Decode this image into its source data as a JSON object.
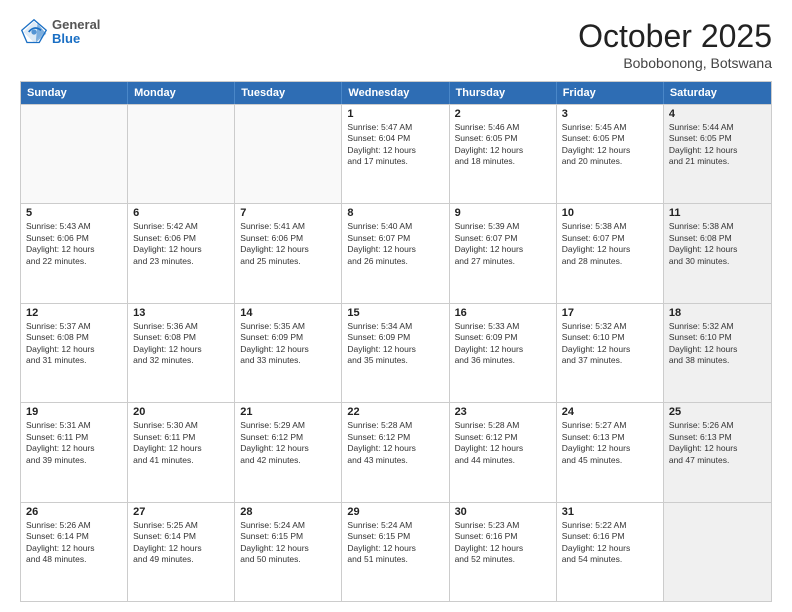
{
  "header": {
    "logo": {
      "general": "General",
      "blue": "Blue"
    },
    "title": "October 2025",
    "location": "Bobobonong, Botswana"
  },
  "days_of_week": [
    "Sunday",
    "Monday",
    "Tuesday",
    "Wednesday",
    "Thursday",
    "Friday",
    "Saturday"
  ],
  "weeks": [
    [
      {
        "day": "",
        "empty": true,
        "shaded": false,
        "lines": []
      },
      {
        "day": "",
        "empty": true,
        "shaded": false,
        "lines": []
      },
      {
        "day": "",
        "empty": true,
        "shaded": false,
        "lines": []
      },
      {
        "day": "1",
        "empty": false,
        "shaded": false,
        "lines": [
          "Sunrise: 5:47 AM",
          "Sunset: 6:04 PM",
          "Daylight: 12 hours",
          "and 17 minutes."
        ]
      },
      {
        "day": "2",
        "empty": false,
        "shaded": false,
        "lines": [
          "Sunrise: 5:46 AM",
          "Sunset: 6:05 PM",
          "Daylight: 12 hours",
          "and 18 minutes."
        ]
      },
      {
        "day": "3",
        "empty": false,
        "shaded": false,
        "lines": [
          "Sunrise: 5:45 AM",
          "Sunset: 6:05 PM",
          "Daylight: 12 hours",
          "and 20 minutes."
        ]
      },
      {
        "day": "4",
        "empty": false,
        "shaded": true,
        "lines": [
          "Sunrise: 5:44 AM",
          "Sunset: 6:05 PM",
          "Daylight: 12 hours",
          "and 21 minutes."
        ]
      }
    ],
    [
      {
        "day": "5",
        "empty": false,
        "shaded": false,
        "lines": [
          "Sunrise: 5:43 AM",
          "Sunset: 6:06 PM",
          "Daylight: 12 hours",
          "and 22 minutes."
        ]
      },
      {
        "day": "6",
        "empty": false,
        "shaded": false,
        "lines": [
          "Sunrise: 5:42 AM",
          "Sunset: 6:06 PM",
          "Daylight: 12 hours",
          "and 23 minutes."
        ]
      },
      {
        "day": "7",
        "empty": false,
        "shaded": false,
        "lines": [
          "Sunrise: 5:41 AM",
          "Sunset: 6:06 PM",
          "Daylight: 12 hours",
          "and 25 minutes."
        ]
      },
      {
        "day": "8",
        "empty": false,
        "shaded": false,
        "lines": [
          "Sunrise: 5:40 AM",
          "Sunset: 6:07 PM",
          "Daylight: 12 hours",
          "and 26 minutes."
        ]
      },
      {
        "day": "9",
        "empty": false,
        "shaded": false,
        "lines": [
          "Sunrise: 5:39 AM",
          "Sunset: 6:07 PM",
          "Daylight: 12 hours",
          "and 27 minutes."
        ]
      },
      {
        "day": "10",
        "empty": false,
        "shaded": false,
        "lines": [
          "Sunrise: 5:38 AM",
          "Sunset: 6:07 PM",
          "Daylight: 12 hours",
          "and 28 minutes."
        ]
      },
      {
        "day": "11",
        "empty": false,
        "shaded": true,
        "lines": [
          "Sunrise: 5:38 AM",
          "Sunset: 6:08 PM",
          "Daylight: 12 hours",
          "and 30 minutes."
        ]
      }
    ],
    [
      {
        "day": "12",
        "empty": false,
        "shaded": false,
        "lines": [
          "Sunrise: 5:37 AM",
          "Sunset: 6:08 PM",
          "Daylight: 12 hours",
          "and 31 minutes."
        ]
      },
      {
        "day": "13",
        "empty": false,
        "shaded": false,
        "lines": [
          "Sunrise: 5:36 AM",
          "Sunset: 6:08 PM",
          "Daylight: 12 hours",
          "and 32 minutes."
        ]
      },
      {
        "day": "14",
        "empty": false,
        "shaded": false,
        "lines": [
          "Sunrise: 5:35 AM",
          "Sunset: 6:09 PM",
          "Daylight: 12 hours",
          "and 33 minutes."
        ]
      },
      {
        "day": "15",
        "empty": false,
        "shaded": false,
        "lines": [
          "Sunrise: 5:34 AM",
          "Sunset: 6:09 PM",
          "Daylight: 12 hours",
          "and 35 minutes."
        ]
      },
      {
        "day": "16",
        "empty": false,
        "shaded": false,
        "lines": [
          "Sunrise: 5:33 AM",
          "Sunset: 6:09 PM",
          "Daylight: 12 hours",
          "and 36 minutes."
        ]
      },
      {
        "day": "17",
        "empty": false,
        "shaded": false,
        "lines": [
          "Sunrise: 5:32 AM",
          "Sunset: 6:10 PM",
          "Daylight: 12 hours",
          "and 37 minutes."
        ]
      },
      {
        "day": "18",
        "empty": false,
        "shaded": true,
        "lines": [
          "Sunrise: 5:32 AM",
          "Sunset: 6:10 PM",
          "Daylight: 12 hours",
          "and 38 minutes."
        ]
      }
    ],
    [
      {
        "day": "19",
        "empty": false,
        "shaded": false,
        "lines": [
          "Sunrise: 5:31 AM",
          "Sunset: 6:11 PM",
          "Daylight: 12 hours",
          "and 39 minutes."
        ]
      },
      {
        "day": "20",
        "empty": false,
        "shaded": false,
        "lines": [
          "Sunrise: 5:30 AM",
          "Sunset: 6:11 PM",
          "Daylight: 12 hours",
          "and 41 minutes."
        ]
      },
      {
        "day": "21",
        "empty": false,
        "shaded": false,
        "lines": [
          "Sunrise: 5:29 AM",
          "Sunset: 6:12 PM",
          "Daylight: 12 hours",
          "and 42 minutes."
        ]
      },
      {
        "day": "22",
        "empty": false,
        "shaded": false,
        "lines": [
          "Sunrise: 5:28 AM",
          "Sunset: 6:12 PM",
          "Daylight: 12 hours",
          "and 43 minutes."
        ]
      },
      {
        "day": "23",
        "empty": false,
        "shaded": false,
        "lines": [
          "Sunrise: 5:28 AM",
          "Sunset: 6:12 PM",
          "Daylight: 12 hours",
          "and 44 minutes."
        ]
      },
      {
        "day": "24",
        "empty": false,
        "shaded": false,
        "lines": [
          "Sunrise: 5:27 AM",
          "Sunset: 6:13 PM",
          "Daylight: 12 hours",
          "and 45 minutes."
        ]
      },
      {
        "day": "25",
        "empty": false,
        "shaded": true,
        "lines": [
          "Sunrise: 5:26 AM",
          "Sunset: 6:13 PM",
          "Daylight: 12 hours",
          "and 47 minutes."
        ]
      }
    ],
    [
      {
        "day": "26",
        "empty": false,
        "shaded": false,
        "lines": [
          "Sunrise: 5:26 AM",
          "Sunset: 6:14 PM",
          "Daylight: 12 hours",
          "and 48 minutes."
        ]
      },
      {
        "day": "27",
        "empty": false,
        "shaded": false,
        "lines": [
          "Sunrise: 5:25 AM",
          "Sunset: 6:14 PM",
          "Daylight: 12 hours",
          "and 49 minutes."
        ]
      },
      {
        "day": "28",
        "empty": false,
        "shaded": false,
        "lines": [
          "Sunrise: 5:24 AM",
          "Sunset: 6:15 PM",
          "Daylight: 12 hours",
          "and 50 minutes."
        ]
      },
      {
        "day": "29",
        "empty": false,
        "shaded": false,
        "lines": [
          "Sunrise: 5:24 AM",
          "Sunset: 6:15 PM",
          "Daylight: 12 hours",
          "and 51 minutes."
        ]
      },
      {
        "day": "30",
        "empty": false,
        "shaded": false,
        "lines": [
          "Sunrise: 5:23 AM",
          "Sunset: 6:16 PM",
          "Daylight: 12 hours",
          "and 52 minutes."
        ]
      },
      {
        "day": "31",
        "empty": false,
        "shaded": false,
        "lines": [
          "Sunrise: 5:22 AM",
          "Sunset: 6:16 PM",
          "Daylight: 12 hours",
          "and 54 minutes."
        ]
      },
      {
        "day": "",
        "empty": true,
        "shaded": true,
        "lines": []
      }
    ]
  ]
}
